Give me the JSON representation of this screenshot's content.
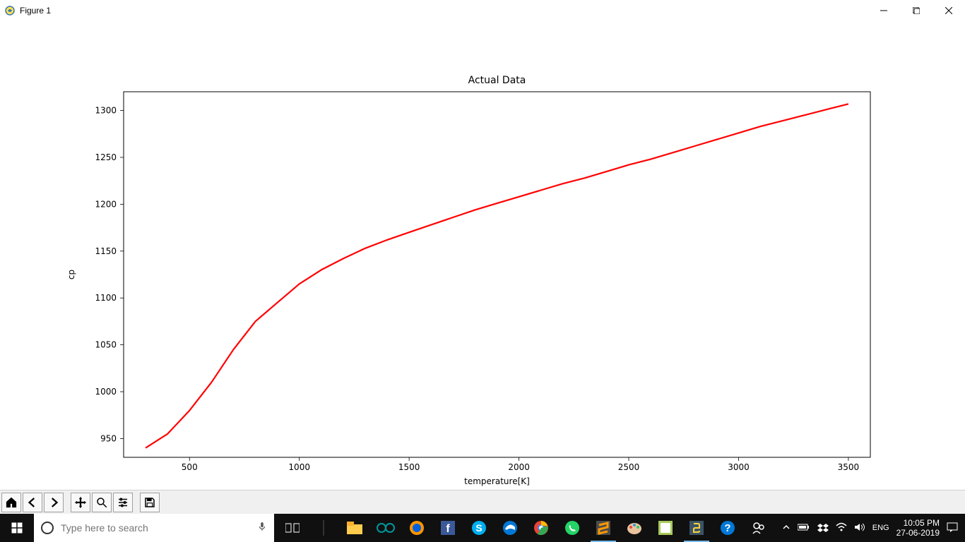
{
  "window": {
    "title": "Figure 1"
  },
  "chart_data": {
    "type": "line",
    "title": "Actual Data",
    "xlabel": "temperature[K]",
    "ylabel": "cp",
    "xlim": [
      200,
      3600
    ],
    "ylim": [
      930,
      1320
    ],
    "xticks": [
      500,
      1000,
      1500,
      2000,
      2500,
      3000,
      3500
    ],
    "yticks": [
      950,
      1000,
      1050,
      1100,
      1150,
      1200,
      1250,
      1300
    ],
    "series": [
      {
        "name": "cp",
        "color": "#ff0000",
        "x": [
          300,
          400,
          500,
          600,
          700,
          800,
          900,
          1000,
          1100,
          1200,
          1300,
          1400,
          1500,
          1600,
          1700,
          1800,
          1900,
          2000,
          2100,
          2200,
          2300,
          2400,
          2500,
          2600,
          2700,
          2800,
          2900,
          3000,
          3100,
          3200,
          3300,
          3400,
          3500
        ],
        "y": [
          940,
          955,
          980,
          1010,
          1045,
          1075,
          1095,
          1115,
          1130,
          1142,
          1153,
          1162,
          1170,
          1178,
          1186,
          1194,
          1201,
          1208,
          1215,
          1222,
          1228,
          1235,
          1242,
          1248,
          1255,
          1262,
          1269,
          1276,
          1283,
          1289,
          1295,
          1301,
          1307
        ]
      }
    ]
  },
  "toolbar": {
    "home": "Home",
    "back": "Back",
    "forward": "Forward",
    "pan": "Pan",
    "zoom": "Zoom",
    "configure": "Configure",
    "save": "Save"
  },
  "taskbar": {
    "search_placeholder": "Type here to search",
    "lang": "ENG",
    "time": "10:05 PM",
    "date": "27-06-2019"
  }
}
